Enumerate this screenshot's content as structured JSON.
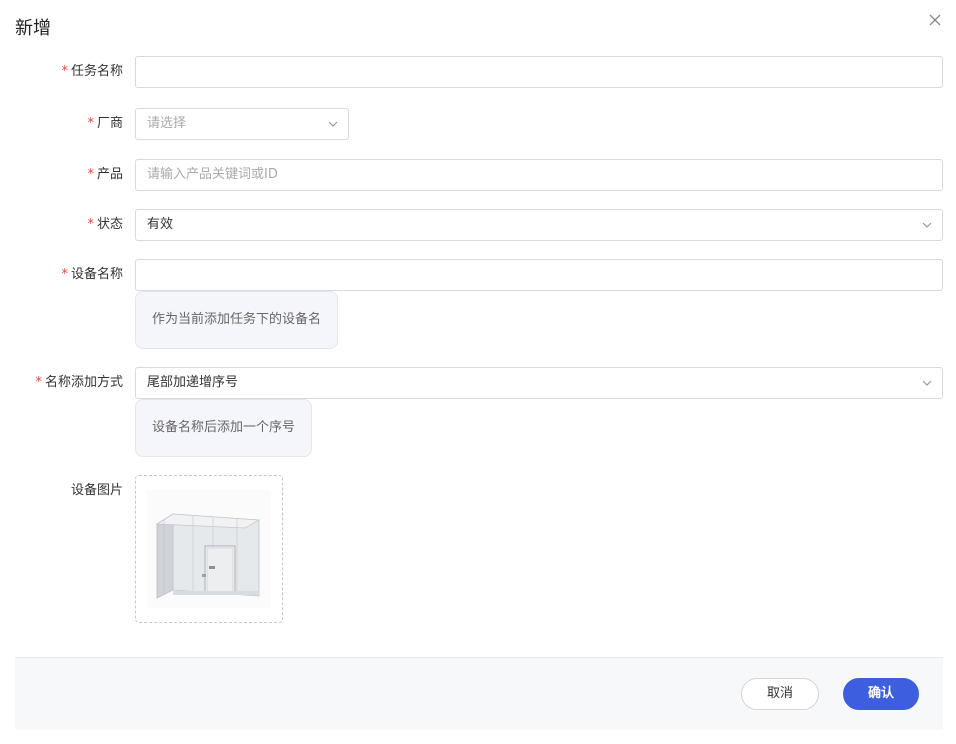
{
  "dialog": {
    "title": "新增"
  },
  "form": {
    "task_name": {
      "label": "任务名称",
      "value": "",
      "required": true
    },
    "vendor": {
      "label": "厂商",
      "placeholder": "请选择",
      "required": true
    },
    "product": {
      "label": "产品",
      "placeholder": "请输入产品关键词或ID",
      "required": true
    },
    "status": {
      "label": "状态",
      "value": "有效",
      "required": true
    },
    "device_name": {
      "label": "设备名称",
      "value": "",
      "hint": "作为当前添加任务下的设备名",
      "required": true
    },
    "name_mode": {
      "label": "名称添加方式",
      "value": "尾部加递增序号",
      "hint": "设备名称后添加一个序号",
      "required": true
    },
    "device_image": {
      "label": "设备图片",
      "required": false
    },
    "required_mark": "*"
  },
  "footer": {
    "cancel_label": "取消",
    "ok_label": "确认"
  },
  "colors": {
    "accent": "#3d5fdf",
    "required": "#e54545",
    "hint_bg": "#f5f6fc"
  },
  "icons": {
    "close": "close-icon",
    "dropdown": "chevron-down-icon"
  }
}
